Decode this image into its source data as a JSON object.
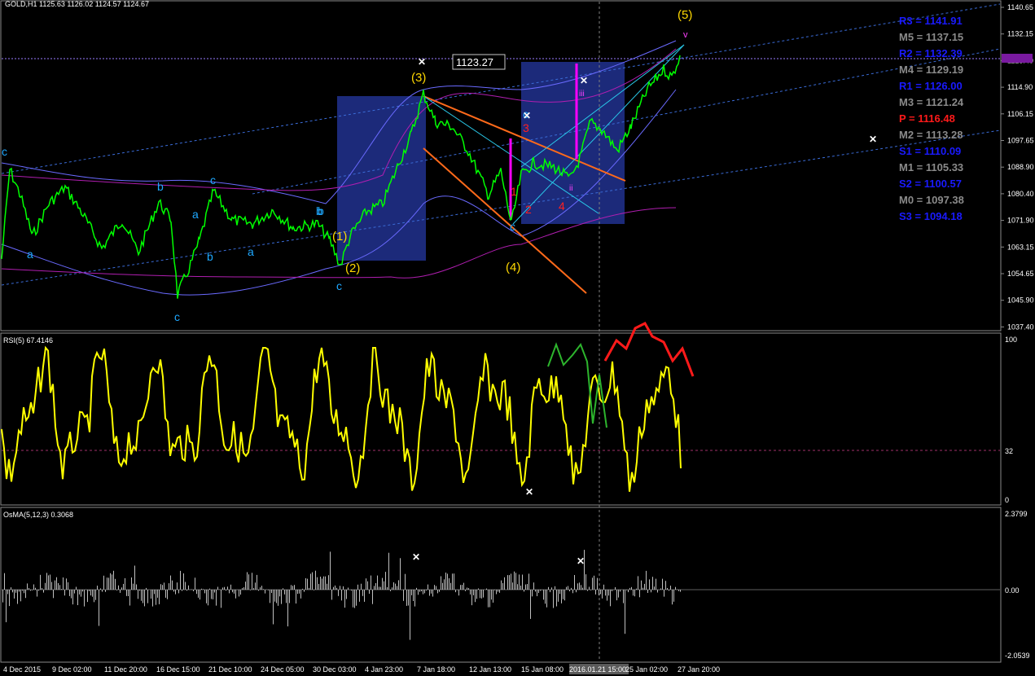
{
  "chart_header": {
    "main": "GOLD,H1  1125.63 1126.02 1124.57 1124.67",
    "rsi": "RSI(5) 67.4146",
    "osma": "OsMA(5,12,3) 0.3068"
  },
  "price_label": "1123.27",
  "price_axis_ticks": [
    "1140.65",
    "1132.15",
    "1123.40",
    "1114.90",
    "1106.15",
    "1097.65",
    "1088.90",
    "1080.40",
    "1071.90",
    "1063.15",
    "1054.65",
    "1045.90",
    "1037.40"
  ],
  "rsi_axis_ticks": [
    "100",
    "32",
    "0"
  ],
  "osma_axis_ticks": [
    "2.3799",
    "0.00",
    "-2.0539"
  ],
  "time_axis": [
    "4 Dec 2015",
    "9 Dec 02:00",
    "11 Dec 20:00",
    "16 Dec 15:00",
    "21 Dec 10:00",
    "24 Dec 05:00",
    "30 Dec 03:00",
    "4 Jan 23:00",
    "7 Jan 18:00",
    "12 Jan 13:00",
    "15 Jan 08:00",
    "2016.01.21 15:00",
    "25 Jan 02:00",
    "27 Jan 20:00"
  ],
  "pivots": [
    {
      "label": "R3 = 1141.91",
      "color": "#1a1aff"
    },
    {
      "label": "M5 = 1137.15",
      "color": "#8a8a8a"
    },
    {
      "label": "R2 = 1132.39",
      "color": "#1a1aff"
    },
    {
      "label": "M4 = 1129.19",
      "color": "#8a8a8a"
    },
    {
      "label": "R1 = 1126.00",
      "color": "#1a1aff"
    },
    {
      "label": "M3 = 1121.24",
      "color": "#8a8a8a"
    },
    {
      "label": "P   = 1116.48",
      "color": "#ff1a1a"
    },
    {
      "label": "M2 = 1113.28",
      "color": "#8a8a8a"
    },
    {
      "label": "S1 = 1110.09",
      "color": "#1a1aff"
    },
    {
      "label": "M1 = 1105.33",
      "color": "#8a8a8a"
    },
    {
      "label": "S2 = 1100.57",
      "color": "#1a1aff"
    },
    {
      "label": "M0 = 1097.38",
      "color": "#8a8a8a"
    },
    {
      "label": "S3 = 1094.18",
      "color": "#1a1aff"
    }
  ],
  "wave_labels": {
    "yellow": [
      "(1)",
      "(2)",
      "(3)",
      "(4)",
      "(5)"
    ],
    "cyan": [
      "c",
      "a",
      "b",
      "c",
      "a",
      "b",
      "c",
      "b",
      "a",
      "b",
      "c",
      "c",
      "c"
    ],
    "red": [
      "1",
      "2",
      "3",
      "4"
    ],
    "magenta": [
      "iii",
      "ii",
      "v"
    ]
  },
  "colors": {
    "price": "#00ff00",
    "rsi": "#ffff00",
    "osma": "#c0c0c0",
    "box": "#1c2a7a",
    "trendline": "#ff6a1a"
  }
}
